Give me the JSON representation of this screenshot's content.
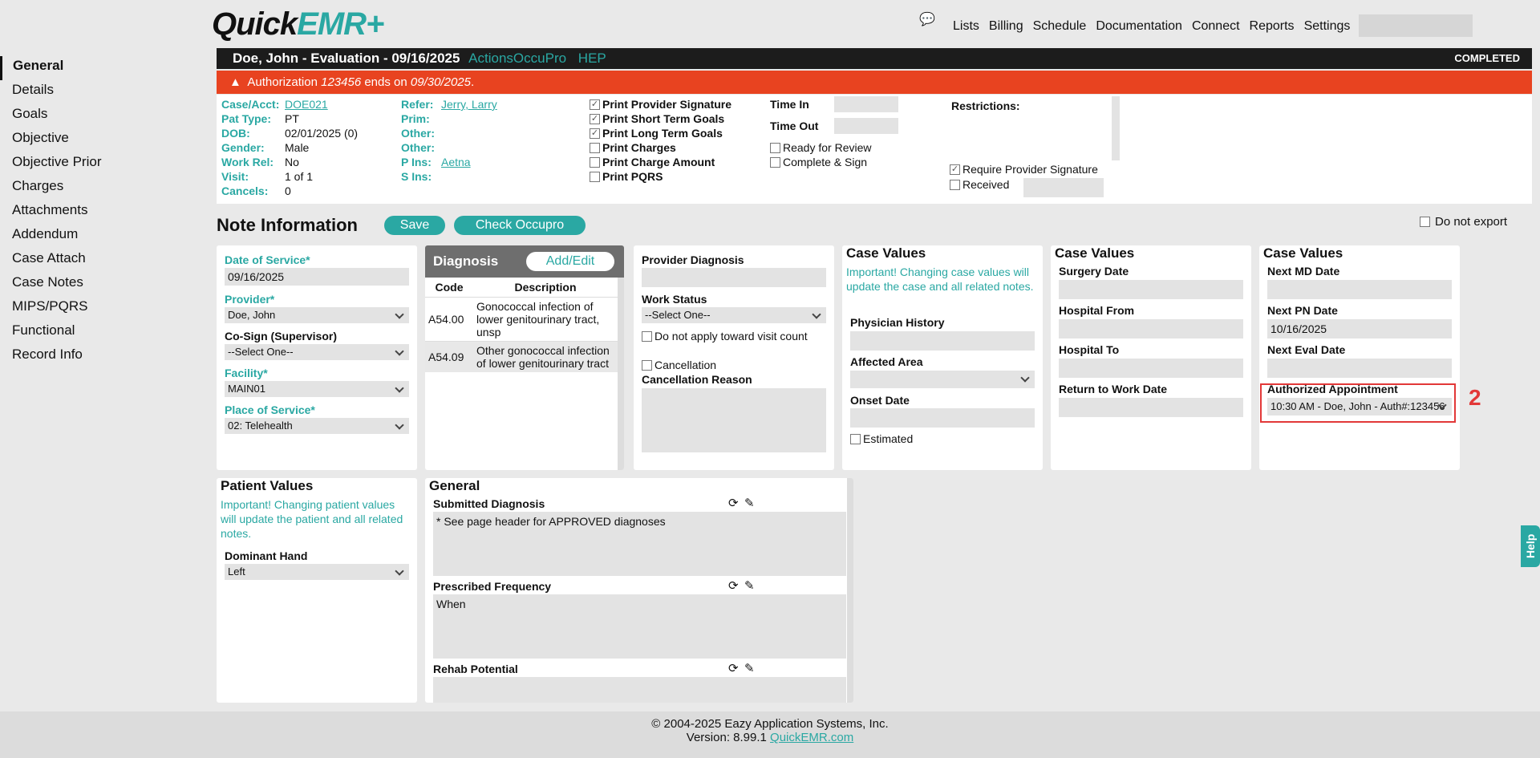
{
  "app": {
    "logo_quick": "Quick",
    "logo_emr": "EMR",
    "logo_plus": "+"
  },
  "topnav": [
    "Lists",
    "Billing",
    "Schedule",
    "Documentation",
    "Connect",
    "Reports",
    "Settings"
  ],
  "sidebar": [
    {
      "label": "General",
      "active": true
    },
    {
      "label": "Details"
    },
    {
      "label": "Goals"
    },
    {
      "label": "Objective"
    },
    {
      "label": "Objective Prior"
    },
    {
      "label": "Charges"
    },
    {
      "label": "Attachments"
    },
    {
      "label": "Addendum"
    },
    {
      "label": "Case Attach"
    },
    {
      "label": "Case Notes"
    },
    {
      "label": "MIPS/PQRS"
    },
    {
      "label": "Functional"
    },
    {
      "label": "Record Info"
    }
  ],
  "header": {
    "title": "Doe, John - Evaluation - 09/16/2025",
    "actions": "Actions",
    "occupro": "OccuPro",
    "hep": "HEP",
    "status": "COMPLETED"
  },
  "auth": {
    "prefix": "Authorization",
    "number": "123456",
    "middle": "ends on",
    "date": "09/30/2025",
    "suffix": "."
  },
  "patient": {
    "case_label": "Case/Acct:",
    "case": "DOE021",
    "type_label": "Pat Type:",
    "type": "PT",
    "dob_label": "DOB:",
    "dob": "02/01/2025 (0)",
    "gender_label": "Gender:",
    "gender": "Male",
    "workrel_label": "Work Rel:",
    "workrel": "No",
    "visit_label": "Visit:",
    "visit": "1 of 1",
    "cancels_label": "Cancels:",
    "cancels": "0",
    "refer_label": "Refer:",
    "refer": "Jerry, Larry",
    "prim_label": "Prim:",
    "other1_label": "Other:",
    "other2_label": "Other:",
    "pins_label": "P Ins:",
    "pins": "Aetna",
    "sins_label": "S Ins:"
  },
  "print_options": [
    {
      "label": "Print Provider Signature",
      "checked": true
    },
    {
      "label": "Print Short Term Goals",
      "checked": true
    },
    {
      "label": "Print Long Term Goals",
      "checked": true
    },
    {
      "label": "Print Charges",
      "checked": false
    },
    {
      "label": "Print Charge Amount",
      "checked": false
    },
    {
      "label": "Print PQRS",
      "checked": false
    }
  ],
  "time": {
    "in_label": "Time In",
    "out_label": "Time Out",
    "ready": "Ready for Review",
    "complete": "Complete & Sign"
  },
  "restrictions": {
    "label": "Restrictions:",
    "require_sig": "Require Provider Signature",
    "require_sig_checked": true,
    "received": "Received"
  },
  "note_info": {
    "title": "Note Information",
    "save": "Save",
    "check": "Check Occupro",
    "no_export": "Do not export"
  },
  "general_fields": {
    "dos_label": "Date of Service*",
    "dos": "09/16/2025",
    "provider_label": "Provider*",
    "provider": "Doe, John",
    "cosign_label": "Co-Sign (Supervisor)",
    "cosign": "--Select One--",
    "facility_label": "Facility*",
    "facility": "MAIN01",
    "pos_label": "Place of Service*",
    "pos": "02: Telehealth"
  },
  "diagnosis": {
    "title": "Diagnosis",
    "add_edit": "Add/Edit",
    "col_code": "Code",
    "col_desc": "Description",
    "rows": [
      {
        "code": "A54.00",
        "desc": "Gonococcal infection of lower genitourinary tract, unsp"
      },
      {
        "code": "A54.09",
        "desc": "Other gonococcal infection of lower genitourinary tract"
      }
    ]
  },
  "provider_col": {
    "prov_diag_label": "Provider Diagnosis",
    "work_status_label": "Work Status",
    "work_status": "--Select One--",
    "no_visit_count": "Do not apply toward visit count",
    "cancellation": "Cancellation",
    "cancel_reason_label": "Cancellation Reason"
  },
  "case_values_1": {
    "title": "Case Values",
    "note": "Important! Changing case values will update the case and all related notes.",
    "phys_hist": "Physician History",
    "affected": "Affected Area",
    "onset": "Onset Date",
    "estimated": "Estimated"
  },
  "case_values_2": {
    "title": "Case Values",
    "surgery": "Surgery Date",
    "hosp_from": "Hospital From",
    "hosp_to": "Hospital To",
    "rtw": "Return to Work Date"
  },
  "case_values_3": {
    "title": "Case Values",
    "next_md": "Next MD Date",
    "next_pn": "Next PN Date",
    "next_pn_val": "10/16/2025",
    "next_eval": "Next Eval Date",
    "auth_appt_label": "Authorized Appointment",
    "auth_appt": "10:30 AM - Doe, John - Auth#:123456"
  },
  "annotation": {
    "number": "2"
  },
  "patient_values": {
    "title": "Patient Values",
    "note": "Important! Changing patient values will update the patient and all related notes.",
    "hand_label": "Dominant Hand",
    "hand": "Left"
  },
  "general_section": {
    "title": "General",
    "submitted_label": "Submitted Diagnosis",
    "submitted": "* See page header for APPROVED diagnoses",
    "freq_label": "Prescribed Frequency",
    "freq": "When",
    "rehab_label": "Rehab Potential"
  },
  "help": "Help",
  "footer": {
    "copyright": "© 2004-2025 Eazy Application Systems, Inc.",
    "version": "Version: 8.99.1",
    "site": "QuickEMR.com"
  }
}
